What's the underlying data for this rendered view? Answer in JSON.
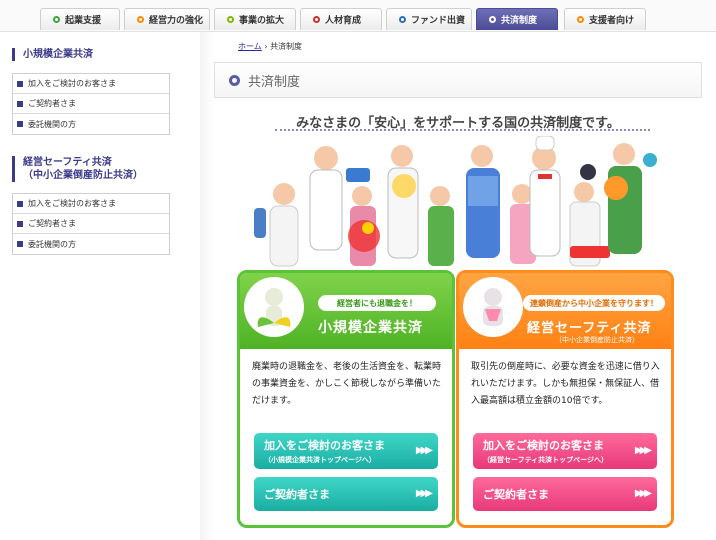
{
  "nav": {
    "tabs": [
      {
        "label": "起業支援",
        "dot": "#3aa83a"
      },
      {
        "label": "経営力の強化",
        "dot": "#ff8a00"
      },
      {
        "label": "事業の拡大",
        "dot": "#7ab800"
      },
      {
        "label": "人材育成",
        "dot": "#c8312a"
      },
      {
        "label": "ファンド出資",
        "dot": "#2a6fb8"
      },
      {
        "label": "共済制度",
        "dot": "#ffffff"
      },
      {
        "label": "支援者向け",
        "dot": "#ff8a00"
      }
    ]
  },
  "sidebar": {
    "sections": [
      {
        "title": "小規模企業共済",
        "items": [
          "加入をご検討のお客さま",
          "ご契約者さま",
          "委託機関の方"
        ]
      },
      {
        "title_line1": "経営セーフティ共済",
        "title_line2": "（中小企業倒産防止共済）",
        "items": [
          "加入をご検討のお客さま",
          "ご契約者さま",
          "委託機関の方"
        ]
      }
    ]
  },
  "breadcrumb": {
    "home": "ホーム",
    "sep": "›",
    "current": "共済制度"
  },
  "page_title": "共済制度",
  "tagline": "みなさまの「安心」をサポートする国の共済制度です。",
  "cards": [
    {
      "pill": "経営者にも退職金を！",
      "title": "小規模企業共済",
      "body": "廃業時の退職金を、老後の生活資金を、転業時の事業資金を、かしこく節税しながら準備いただけます。",
      "btn1_line1": "加入をご検討のお客さま",
      "btn1_line2": "（小規模企業共済トップページへ）",
      "btn2": "ご契約者さま"
    },
    {
      "pill": "連鎖倒産から中小企業を守ります！",
      "title": "経営セーフティ共済",
      "subtitle": "（中小企業倒産防止共済）",
      "body": "取引先の倒産時に、必要な資金を迅速に借り入れいただけます。しかも無担保・無保証人、借入最高額は積立金額の10倍です。",
      "btn1_line1": "加入をご検討のお客さま",
      "btn1_line2": "（経営セーフティ共済トップページへ）",
      "btn2": "ご契約者さま"
    }
  ],
  "colors": {
    "brand": "#4c4c96",
    "green": "#5cc23a",
    "orange": "#ff8c1a",
    "teal": "#1aaea2",
    "pink": "#e8397a"
  }
}
